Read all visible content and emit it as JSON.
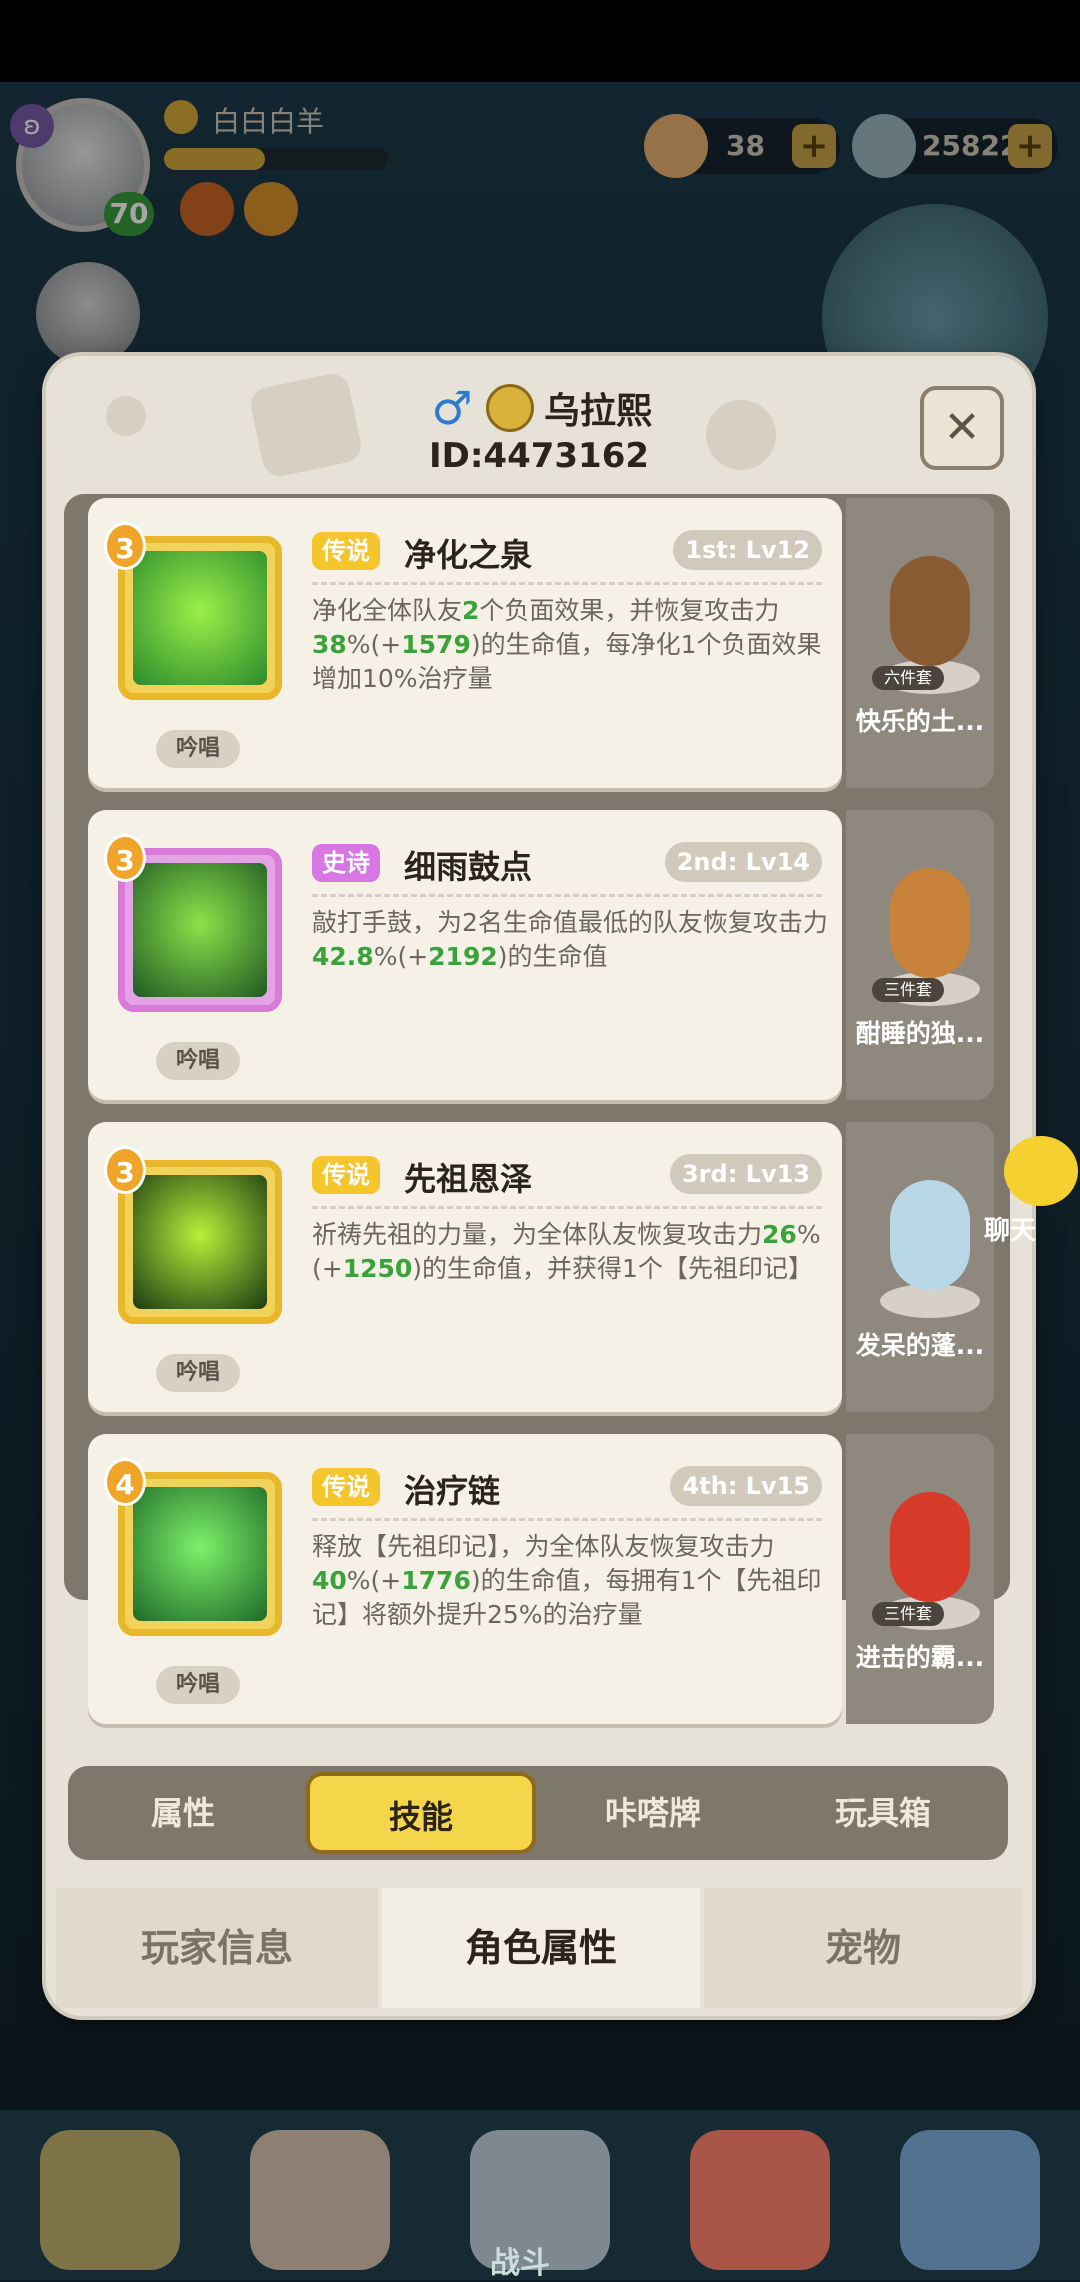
{
  "player": {
    "name": "白白白羊",
    "level": "70",
    "exp_fraction": 0.45
  },
  "resources": [
    {
      "value": "38"
    },
    {
      "value": "25822"
    }
  ],
  "chat_label": "聊天",
  "dialog": {
    "name": "乌拉熙",
    "id": "ID:4473162",
    "close_symbol": "✕"
  },
  "skills": [
    {
      "num": "3",
      "rarity": "传说",
      "rarity_type": "legend",
      "name": "净化之泉",
      "level": "1st: Lv12",
      "desc_parts": [
        "净化全体队友",
        "2",
        "个负面效果，并恢复攻击力",
        "38",
        "%(+",
        "1579",
        ")的生命值，每净化1个负面效果增加10%治疗量"
      ],
      "button": "吟唱",
      "colors": [
        "#2c8a2c",
        "#9bf04a"
      ]
    },
    {
      "num": "3",
      "rarity": "史诗",
      "rarity_type": "epic",
      "name": "细雨鼓点",
      "level": "2nd: Lv14",
      "desc_parts": [
        "敲打手鼓，为2名生命值最低的队友恢复攻击力",
        "42.8",
        "%(+",
        "2192",
        ")的生命值"
      ],
      "button": "吟唱",
      "colors": [
        "#1f5a24",
        "#8ce24a"
      ]
    },
    {
      "num": "3",
      "rarity": "传说",
      "rarity_type": "legend",
      "name": "先祖恩泽",
      "level": "3rd: Lv13",
      "desc_parts": [
        "祈祷先祖的力量，为全体队友恢复攻击力",
        "26",
        "%(+",
        "1250",
        ")的生命值，并获得1个【先祖印记】"
      ],
      "button": "吟唱",
      "colors": [
        "#1a3a12",
        "#b8f03a"
      ]
    },
    {
      "num": "4",
      "rarity": "传说",
      "rarity_type": "legend",
      "name": "治疗链",
      "level": "4th: Lv15",
      "desc_parts": [
        "释放【先祖印记】，为全体队友恢复攻击力",
        "40",
        "%(+",
        "1776",
        ")的生命值，每拥有1个【先祖印记】将额外提升25%的治疗量"
      ],
      "button": "吟唱",
      "colors": [
        "#1e6a28",
        "#7ef06a"
      ]
    }
  ],
  "sets": [
    {
      "tag": "六件套",
      "name": "快乐的土...",
      "color": "#8a5a32"
    },
    {
      "tag": "三件套",
      "name": "酣睡的独...",
      "color": "#c8823a"
    },
    {
      "tag": "",
      "name": "发呆的蓬...",
      "color": "#b8d8e8"
    },
    {
      "tag": "三件套",
      "name": "进击的霸...",
      "color": "#d83a2a"
    }
  ],
  "tabs": [
    "属性",
    "技能",
    "咔嗒牌",
    "玩具箱"
  ],
  "bottom_tabs": [
    "玩家信息",
    "角色属性",
    "宠物"
  ],
  "nav_label": "战斗"
}
